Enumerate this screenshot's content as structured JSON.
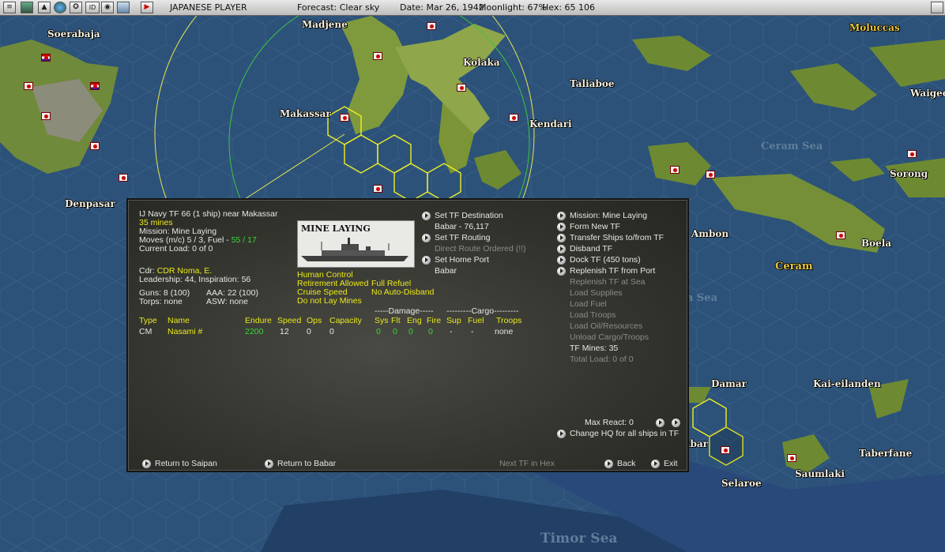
{
  "topbar": {
    "player": "JAPANESE PLAYER",
    "forecast": "Forecast: Clear sky",
    "date": "Date: Mar 26, 1942",
    "moonlight": "Moonlight: 67%",
    "hex": "Hex: 65 106",
    "icons": [
      "options-icon",
      "save-icon",
      "turn-icon",
      "globe-icon",
      "target-icon",
      "info-icon",
      "intel-icon",
      "window-icon",
      "play-icon"
    ]
  },
  "map": {
    "places": [
      "Soerabaja",
      "Madjene",
      "Kolaka",
      "Moluccas",
      "Makassar",
      "Taliaboe",
      "Waigeo",
      "Kendari",
      "Ceram Sea",
      "Sorong",
      "Denpasar",
      "Ambon",
      "Boela",
      "Ceram",
      "Damar",
      "Kai-eilanden",
      "Tanimbar",
      "Saumlaki",
      "Taberfane",
      "Selaroe",
      "Timor Sea",
      "Banda Sea"
    ]
  },
  "dialog": {
    "tf_title": "IJ Navy TF 66 (1 ship) near Makassar",
    "mines": "35 mines",
    "mission": "Mission:  Mine Laying",
    "moves_prefix": "Moves (m/c)  5 / 3, Fuel - ",
    "fuel": "55 / 17",
    "current_load": "Current Load:  0 of 0",
    "cdr_label": "Cdr:",
    "cdr_name": "CDR  Noma, E.",
    "leadership": "Leadership: 44, Inspiration: 56",
    "guns": "Guns: 8 (100)",
    "aaa": "AAA: 22 (100)",
    "torps": "Torps: none",
    "asw": "ASW: none",
    "ship_image_caption": "MINE LAYING",
    "flags": {
      "human_control": "Human Control",
      "retirement": "Retirement Allowed",
      "full_refuel": "Full Refuel",
      "cruise": "Cruise Speed",
      "no_auto_disband": "No Auto-Disband",
      "no_mines": "Do not Lay Mines"
    },
    "group_damage": "-----Damage-----",
    "group_cargo": "---------Cargo---------",
    "columns": [
      "Type",
      "Name",
      "Endure",
      "Speed",
      "Ops",
      "Capacity",
      "Sys",
      "Flt",
      "Eng",
      "Fire",
      "Sup",
      "Fuel",
      "Troops"
    ],
    "ship_row": {
      "type": "CM",
      "name": "Nasami #",
      "endure": "2200",
      "speed": "12",
      "ops": "0",
      "capacity": "0",
      "sys": "0",
      "flt": "0",
      "eng": "0",
      "fire": "0",
      "sup": "-",
      "fuel": "-",
      "troops": "none"
    },
    "middle_options": {
      "set_destination": "Set TF Destination",
      "destination_value": "Babar - 76,117",
      "set_routing": "Set TF Routing",
      "direct_route": "Direct Route Ordered (!!)",
      "set_home_port": "Set Home Port",
      "home_port_value": "Babar"
    },
    "right_options": {
      "mission": "Mission: Mine Laying",
      "form_new": "Form New TF",
      "transfer": "Transfer Ships to/from TF",
      "disband": "Disband TF",
      "dock": "Dock TF (450 tons)",
      "replenish_port": "Replenish TF from Port",
      "replenish_sea": "Replenish TF at Sea",
      "load_supplies": "Load Supplies",
      "load_fuel": "Load Fuel",
      "load_troops": "Load Troops",
      "load_oil": "Load Oil/Resources",
      "unload": "Unload Cargo/Troops",
      "tf_mines": "TF Mines: 35",
      "total_load": "Total Load: 0 of 0"
    },
    "max_react": "Max React:  0",
    "change_hq": "Change HQ for all ships in TF",
    "return_saipan": "Return to Saipan",
    "return_babar": "Return to Babar",
    "next_tf": "Next TF in Hex",
    "back": "Back",
    "exit": "Exit"
  }
}
